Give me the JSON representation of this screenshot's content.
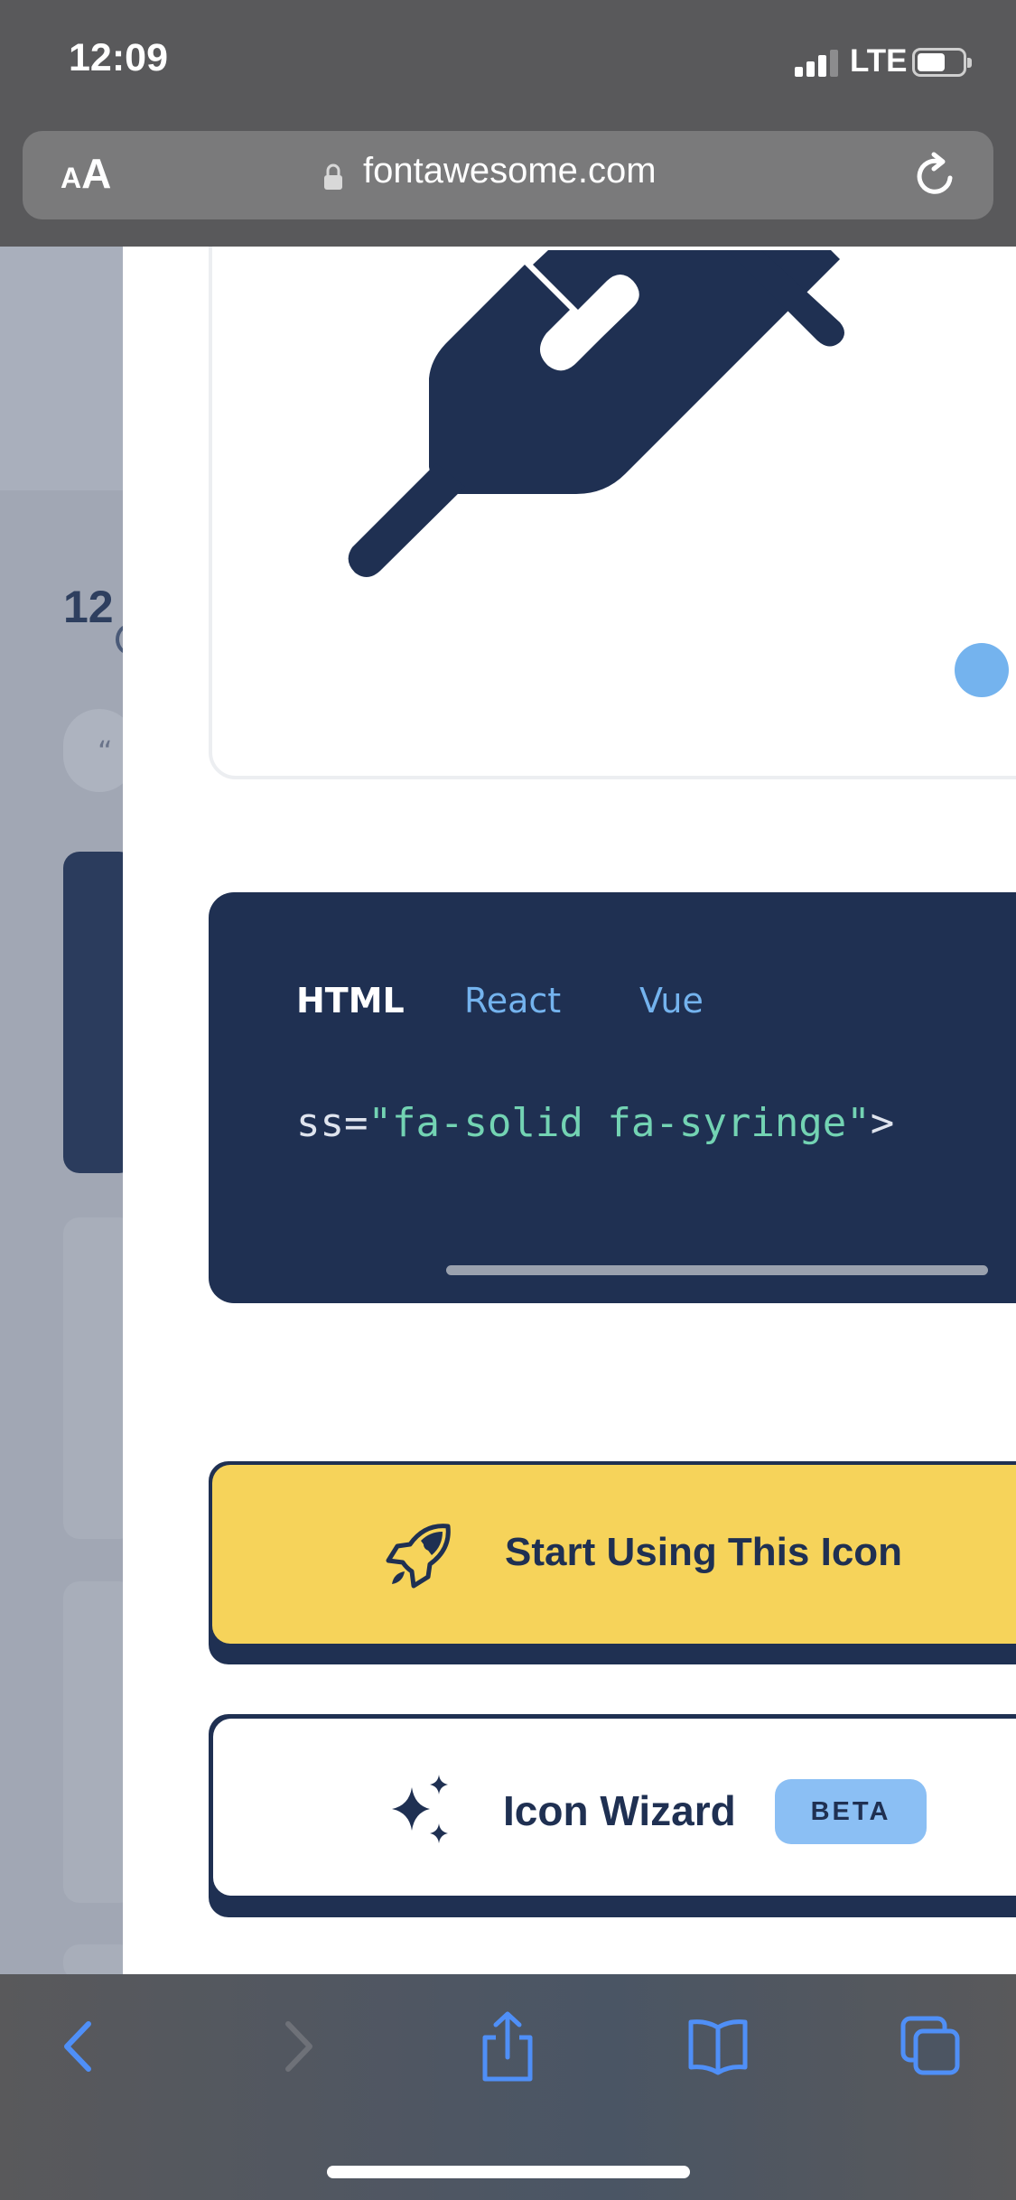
{
  "status_bar": {
    "time": "12:09",
    "network": "LTE"
  },
  "browser": {
    "text_size_small": "A",
    "text_size_large": "A",
    "url": "fontawesome.com"
  },
  "background_page": {
    "count_fragment": "12",
    "quote_fragment": "“"
  },
  "modal": {
    "icon_name": "syringe-icon",
    "code_tabs": [
      "HTML",
      "React",
      "Vue"
    ],
    "active_tab": "HTML",
    "code_prefix": "ss=",
    "code_string": "\"fa-solid fa-syringe\"",
    "code_suffix": ">",
    "primary_button_label": "Start Using This Icon",
    "secondary_button_label": "Icon Wizard",
    "secondary_button_badge": "BETA"
  },
  "colors": {
    "navy": "#1f3052",
    "yellow": "#f6d35a",
    "accent_blue": "#74b3ee",
    "code_green": "#73d3b3",
    "ios_blue": "#4f8ff7"
  }
}
